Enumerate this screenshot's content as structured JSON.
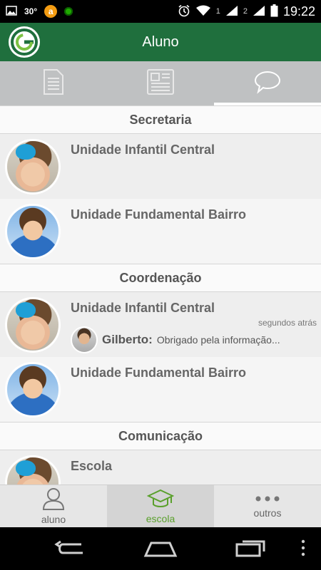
{
  "status_bar": {
    "temperature": "30°",
    "sim1": "1",
    "sim2": "2",
    "time": "19:22"
  },
  "app_bar": {
    "title": "Aluno",
    "logo_letter": "G"
  },
  "tabs": [
    {
      "icon": "document-icon",
      "active": false
    },
    {
      "icon": "newspaper-icon",
      "active": false
    },
    {
      "icon": "chat-bubble-icon",
      "active": true
    }
  ],
  "sections": [
    {
      "title": "Secretaria",
      "items": [
        {
          "title": "Unidade Infantil Central"
        },
        {
          "title": "Unidade Fundamental Bairro"
        }
      ]
    },
    {
      "title": "Coordenação",
      "items": [
        {
          "title": "Unidade Infantil Central",
          "timestamp": "segundos atrás",
          "last_message": {
            "sender": "Gilberto:",
            "text": "Obrigado pela informação..."
          }
        },
        {
          "title": "Unidade Fundamental Bairro"
        }
      ]
    },
    {
      "title": "Comunicação",
      "items": [
        {
          "title": "Escola"
        }
      ]
    }
  ],
  "bottom_nav": [
    {
      "label": "aluno",
      "icon": "person-icon",
      "active": false
    },
    {
      "label": "escola",
      "icon": "graduation-cap-icon",
      "active": true
    },
    {
      "label": "outros",
      "icon": "more-dots-icon",
      "active": false
    }
  ],
  "colors": {
    "primary": "#1f6f3d",
    "accent": "#5aa02c",
    "tab_bar": "#bfc1c2"
  }
}
